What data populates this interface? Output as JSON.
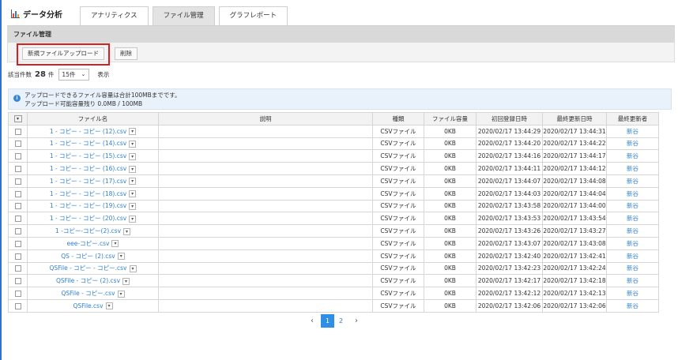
{
  "app": {
    "title": "データ分析"
  },
  "tabs": [
    {
      "label": "アナリティクス",
      "active": false
    },
    {
      "label": "ファイル管理",
      "active": true
    },
    {
      "label": "グラフレポート",
      "active": false
    }
  ],
  "section": {
    "title": "ファイル管理"
  },
  "toolbar": {
    "upload_label": "新規ファイルアップロード",
    "delete_label": "削除"
  },
  "count": {
    "label": "該当件数",
    "value": "28",
    "unit": "件",
    "per_page": "15件",
    "display_label": "表示"
  },
  "info": {
    "line1": "アップロードできるファイル容量は合計100MBまでです。",
    "line2": "アップロード可能容量残り 0.0MB / 100MB"
  },
  "table": {
    "headers": [
      "ファイル名",
      "説明",
      "種類",
      "ファイル容量",
      "初回登録日時",
      "最終更新日時",
      "最終更新者"
    ],
    "rows": [
      {
        "name": "1 - コピー - コピー (12).csv",
        "desc": "",
        "type": "CSVファイル",
        "size": "0KB",
        "created": "2020/02/17 13:44:29",
        "updated": "2020/02/17 13:44:31",
        "updater": "新谷"
      },
      {
        "name": "1 - コピー - コピー (14).csv",
        "desc": "",
        "type": "CSVファイル",
        "size": "0KB",
        "created": "2020/02/17 13:44:20",
        "updated": "2020/02/17 13:44:22",
        "updater": "新谷"
      },
      {
        "name": "1 - コピー - コピー (15).csv",
        "desc": "",
        "type": "CSVファイル",
        "size": "0KB",
        "created": "2020/02/17 13:44:16",
        "updated": "2020/02/17 13:44:17",
        "updater": "新谷"
      },
      {
        "name": "1 - コピー - コピー (16).csv",
        "desc": "",
        "type": "CSVファイル",
        "size": "0KB",
        "created": "2020/02/17 13:44:11",
        "updated": "2020/02/17 13:44:12",
        "updater": "新谷"
      },
      {
        "name": "1 - コピー - コピー (17).csv",
        "desc": "",
        "type": "CSVファイル",
        "size": "0KB",
        "created": "2020/02/17 13:44:07",
        "updated": "2020/02/17 13:44:08",
        "updater": "新谷"
      },
      {
        "name": "1 - コピー - コピー (18).csv",
        "desc": "",
        "type": "CSVファイル",
        "size": "0KB",
        "created": "2020/02/17 13:44:03",
        "updated": "2020/02/17 13:44:04",
        "updater": "新谷"
      },
      {
        "name": "1 - コピー - コピー (19).csv",
        "desc": "",
        "type": "CSVファイル",
        "size": "0KB",
        "created": "2020/02/17 13:43:58",
        "updated": "2020/02/17 13:44:00",
        "updater": "新谷"
      },
      {
        "name": "1 - コピー - コピー (20).csv",
        "desc": "",
        "type": "CSVファイル",
        "size": "0KB",
        "created": "2020/02/17 13:43:53",
        "updated": "2020/02/17 13:43:54",
        "updater": "新谷"
      },
      {
        "name": "1 -コピー-コピー(2).csv",
        "desc": "",
        "type": "CSVファイル",
        "size": "0KB",
        "created": "2020/02/17 13:43:26",
        "updated": "2020/02/17 13:43:27",
        "updater": "新谷"
      },
      {
        "name": "eee-コピー.csv",
        "desc": "",
        "type": "CSVファイル",
        "size": "0KB",
        "created": "2020/02/17 13:43:07",
        "updated": "2020/02/17 13:43:08",
        "updater": "新谷"
      },
      {
        "name": "QS - コピー (2).csv",
        "desc": "",
        "type": "CSVファイル",
        "size": "0KB",
        "created": "2020/02/17 13:42:40",
        "updated": "2020/02/17 13:42:41",
        "updater": "新谷"
      },
      {
        "name": "QSFile - コピー - コピー.csv",
        "desc": "",
        "type": "CSVファイル",
        "size": "0KB",
        "created": "2020/02/17 13:42:23",
        "updated": "2020/02/17 13:42:24",
        "updater": "新谷"
      },
      {
        "name": "QSFile - コピー (2).csv",
        "desc": "",
        "type": "CSVファイル",
        "size": "0KB",
        "created": "2020/02/17 13:42:17",
        "updated": "2020/02/17 13:42:18",
        "updater": "新谷"
      },
      {
        "name": "QSFile - コピー.csv",
        "desc": "",
        "type": "CSVファイル",
        "size": "0KB",
        "created": "2020/02/17 13:42:12",
        "updated": "2020/02/17 13:42:13",
        "updater": "新谷"
      },
      {
        "name": "QSFile.csv",
        "desc": "",
        "type": "CSVファイル",
        "size": "0KB",
        "created": "2020/02/17 13:42:06",
        "updated": "2020/02/17 13:42:06",
        "updater": "新谷"
      }
    ]
  },
  "pagination": {
    "prev": "‹",
    "pages": [
      "1",
      "2"
    ],
    "current": "1",
    "next": "›"
  },
  "colors": {
    "accent": "#2f8fe4",
    "link": "#2f7fd0",
    "highlight_border": "#d81e1e",
    "info_bg": "#e9f1fa"
  }
}
